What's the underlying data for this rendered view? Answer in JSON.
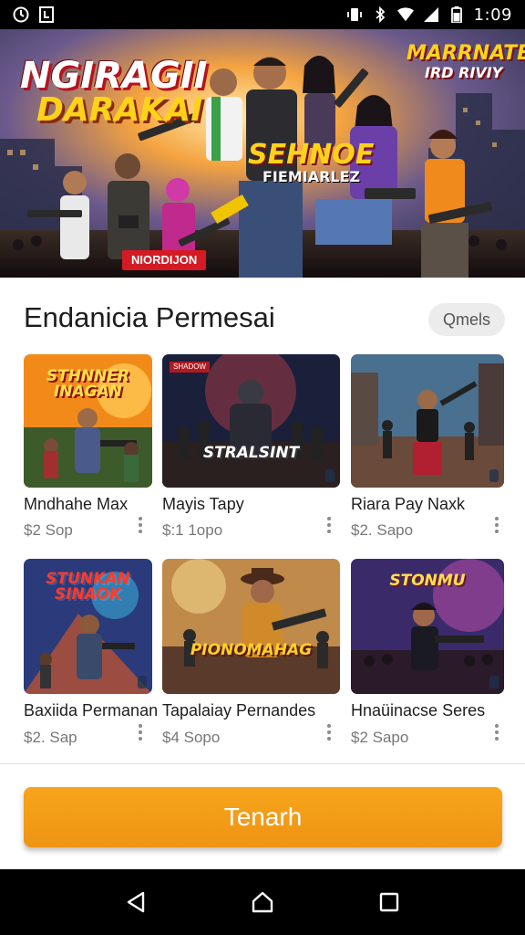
{
  "status_bar": {
    "time": "1:09",
    "icons": [
      "clock-icon",
      "notification-icon",
      "vibrate-icon",
      "bluetooth-icon",
      "wifi-icon",
      "signal-icon",
      "battery-icon"
    ]
  },
  "hero": {
    "title_line1": "NGIRAGII",
    "title_line2": "DARAKAI",
    "right_line1": "MARRNATE",
    "right_line2": "IRD RIVIY",
    "mid_line1": "SEHNOE",
    "mid_line2": "FIEMIARLEZ",
    "badge": "NIORDIJON"
  },
  "section": {
    "title": "Endanicia Permesai",
    "more_label": "Qmels"
  },
  "games": [
    {
      "name": "Mndhahe Max",
      "price": "$2 Sop",
      "art_title": "STHNNER INAGAN",
      "tag_tl": ""
    },
    {
      "name": "Mayis Tapy",
      "price": "$:1 1opo",
      "art_title": "STRALSINT",
      "tag_tl": "SHADOW"
    },
    {
      "name": "Riara Pay Naxk",
      "price": "$2. Sapo",
      "art_title": "",
      "tag_tl": ""
    },
    {
      "name": "Baxiida Permanan",
      "price": "$2. Sap",
      "art_title": "STUNKAN SINAOK",
      "tag_tl": ""
    },
    {
      "name": "Tapalaiay Pernandes",
      "price": "$4 Sopo",
      "art_title": "PIONOMAHAG",
      "tag_tl": ""
    },
    {
      "name": "Hnaüinacse Seres",
      "price": "$2 Sapo",
      "art_title": "STONMU",
      "tag_tl": ""
    }
  ],
  "cta": {
    "label": "Tenarh"
  },
  "nav": {
    "icons": [
      "back-icon",
      "home-icon",
      "recents-icon"
    ]
  },
  "colors": {
    "accent": "#f29a16",
    "hero_yellow": "#ffd21a",
    "hero_red": "#d31b24"
  }
}
